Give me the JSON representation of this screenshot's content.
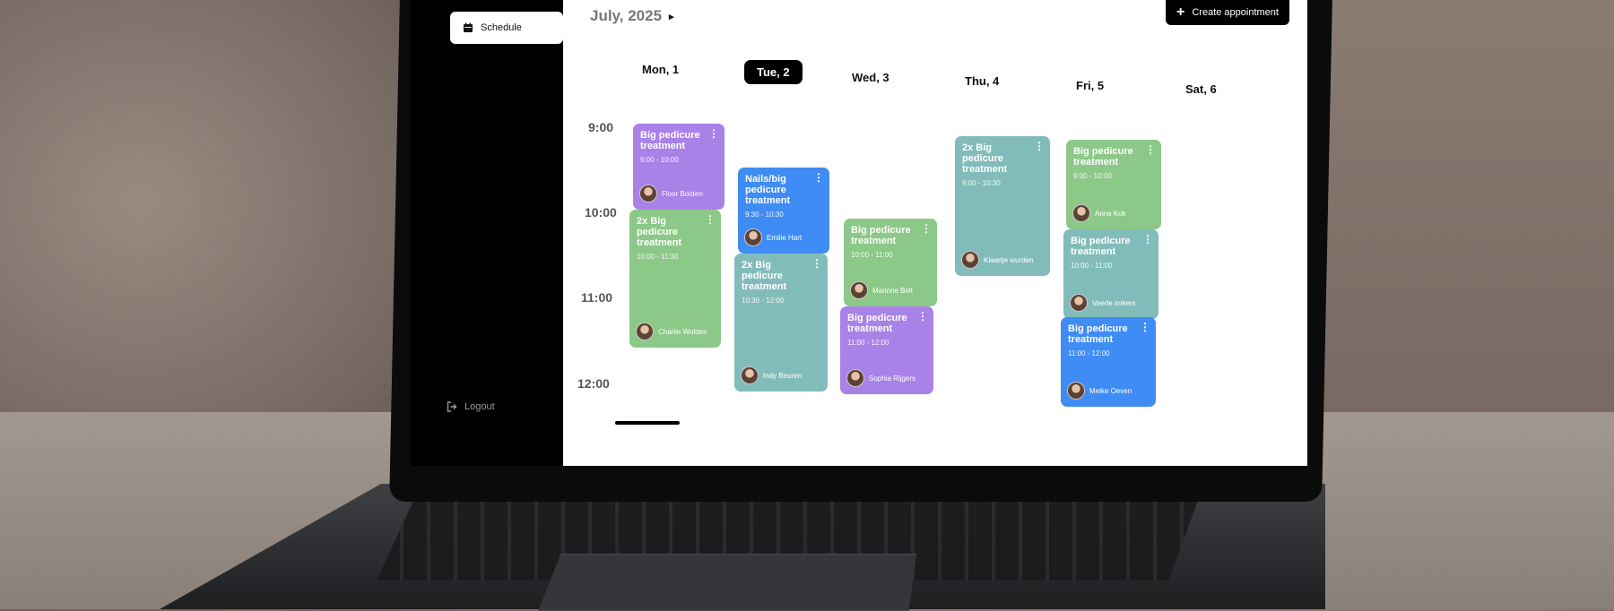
{
  "header": {
    "month_title": "July, 2025",
    "next_icon": "chevron-right-icon",
    "create_label": "Create appointment"
  },
  "sidebar": {
    "schedule_label": "Schedule",
    "logout_label": "Logout"
  },
  "days": [
    {
      "label": "Mon, 1",
      "active": false
    },
    {
      "label": "Tue, 2",
      "active": true
    },
    {
      "label": "Wed, 3",
      "active": false
    },
    {
      "label": "Thu, 4",
      "active": false
    },
    {
      "label": "Fri, 5",
      "active": false
    },
    {
      "label": "Sat, 6",
      "active": false
    }
  ],
  "times": [
    "9:00",
    "10:00",
    "11:00",
    "12:00"
  ],
  "events": [
    {
      "title": "Big pedicure treatment",
      "time": "9:00 - 10:00",
      "person": "Floor Booten",
      "color": "#a982e8"
    },
    {
      "title": "2x Big pedicure treatment",
      "time": "10:00 - 11:30",
      "person": "Charlie Wolden",
      "color": "#8cc888"
    },
    {
      "title": "Nails/big pedicure treatment",
      "time": "9:30 - 10:30",
      "person": "Emilie Hart",
      "color": "#3f8cf5"
    },
    {
      "title": "2x Big pedicure treatment",
      "time": "10:30 - 12:00",
      "person": "Indy Beuren",
      "color": "#82bcba"
    },
    {
      "title": "Big pedicure treatment",
      "time": "10:00 - 11:00",
      "person": "Marinne Belt",
      "color": "#8cc888"
    },
    {
      "title": "Big pedicure treatment",
      "time": "11:00 - 12:00",
      "person": "Sophia Rijgers",
      "color": "#a982e8"
    },
    {
      "title": "2x Big pedicure treatment",
      "time": "9:00 - 10:30",
      "person": "Klaartje wurden",
      "color": "#82bcba"
    },
    {
      "title": "Big pedicure treatment",
      "time": "9:00 - 10:00",
      "person": "Anne Kok",
      "color": "#8cc888"
    },
    {
      "title": "Big pedicure treatment",
      "time": "10:00 - 11:00",
      "person": "Veerle imkers",
      "color": "#82bcba"
    },
    {
      "title": "Big pedicure treatment",
      "time": "11:00 - 12:00",
      "person": "Meike Oeven",
      "color": "#3f8cf5"
    }
  ]
}
